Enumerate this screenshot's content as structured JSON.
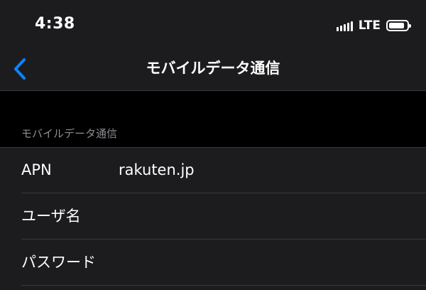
{
  "status_bar": {
    "time": "4:38",
    "network": "LTE",
    "signal_bars_on": 4
  },
  "nav": {
    "back_icon": "chevron-left-icon",
    "title": "モバイルデータ通信"
  },
  "section": {
    "header": "モバイルデータ通信"
  },
  "rows": [
    {
      "label": "APN",
      "value": "rakuten.jp"
    },
    {
      "label": "ユーザ名",
      "value": ""
    },
    {
      "label": "パスワード",
      "value": ""
    }
  ],
  "colors": {
    "accent": "#0a84ff",
    "background": "#000000",
    "cell": "#1c1c1e",
    "separator": "#38383a",
    "secondary_text": "#8e8e93"
  }
}
